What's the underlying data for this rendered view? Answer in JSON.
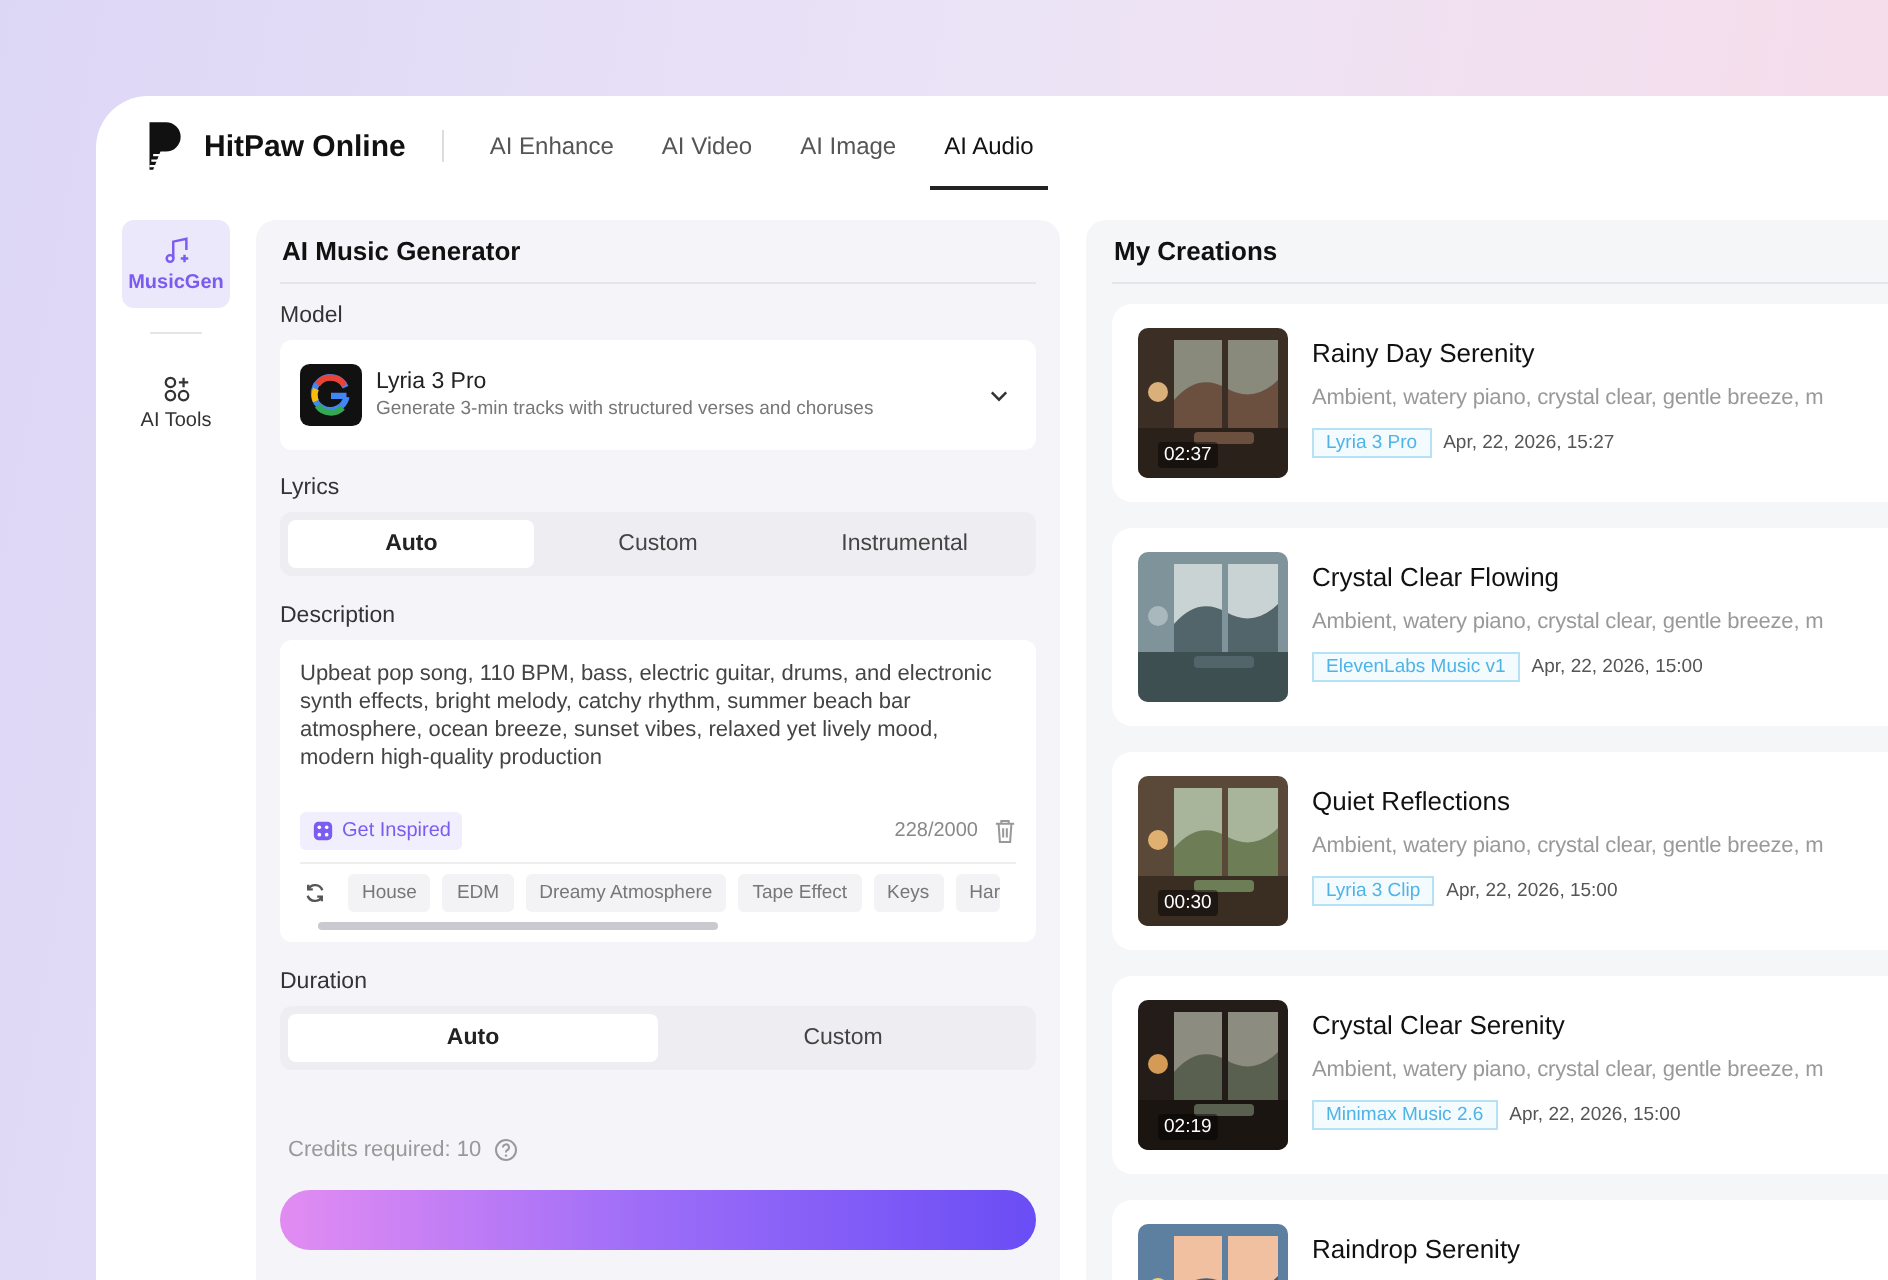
{
  "header": {
    "brand": "HitPaw Online",
    "nav": [
      {
        "label": "AI Enhance",
        "selected": false
      },
      {
        "label": "AI Video",
        "selected": false
      },
      {
        "label": "AI Image",
        "selected": false
      },
      {
        "label": "AI Audio",
        "selected": true
      }
    ]
  },
  "sidebar": [
    {
      "label": "MusicGen",
      "kind": "music",
      "selected": true
    },
    {
      "label": "AI Tools",
      "kind": "tools",
      "selected": false
    }
  ],
  "generator": {
    "title": "AI Music Generator",
    "model": {
      "label": "Model",
      "name": "Lyria 3 Pro",
      "description": "Generate 3-min tracks with structured verses and choruses"
    },
    "lyrics": {
      "label": "Lyrics",
      "options": [
        {
          "label": "Auto",
          "selected": true
        },
        {
          "label": "Custom",
          "selected": false
        },
        {
          "label": "Instrumental",
          "selected": false
        }
      ]
    },
    "description": {
      "label": "Description",
      "value": "Upbeat pop song, 110 BPM, bass, electric guitar, drums, and electronic synth effects, bright melody, catchy rhythm, summer beach bar atmosphere, ocean breeze, sunset vibes, relaxed yet lively mood, modern high-quality production",
      "inspire": "Get Inspired",
      "count": "228/2000",
      "tags": [
        "House",
        "EDM",
        "Dreamy Atmosphere",
        "Tape Effect",
        "Keys",
        "Har"
      ]
    },
    "duration": {
      "label": "Duration",
      "options": [
        {
          "label": "Auto",
          "selected": true
        },
        {
          "label": "Custom",
          "selected": false
        }
      ]
    },
    "credits": "Credits required: 10"
  },
  "creations": {
    "title": "My Creations",
    "items": [
      {
        "title": "Rainy Day Serenity",
        "description": "Ambient, watery piano, crystal clear, gentle breeze, m",
        "model": "Lyria 3 Pro",
        "date": "Apr, 22, 2026, 15:27",
        "duration": "02:37"
      },
      {
        "title": "Crystal Clear Flowing",
        "description": "Ambient, watery piano, crystal clear, gentle breeze, m",
        "model": "ElevenLabs Music v1",
        "date": "Apr, 22, 2026, 15:00"
      },
      {
        "title": "Quiet Reflections",
        "description": "Ambient, watery piano, crystal clear, gentle breeze, m",
        "model": "Lyria 3 Clip",
        "date": "Apr, 22, 2026, 15:00",
        "duration": "00:30"
      },
      {
        "title": "Crystal Clear Serenity",
        "description": "Ambient, watery piano, crystal clear, gentle breeze, m",
        "model": "Minimax Music 2.6",
        "date": "Apr, 22, 2026, 15:00",
        "duration": "02:19"
      },
      {
        "title": "Raindrop Serenity"
      }
    ]
  }
}
